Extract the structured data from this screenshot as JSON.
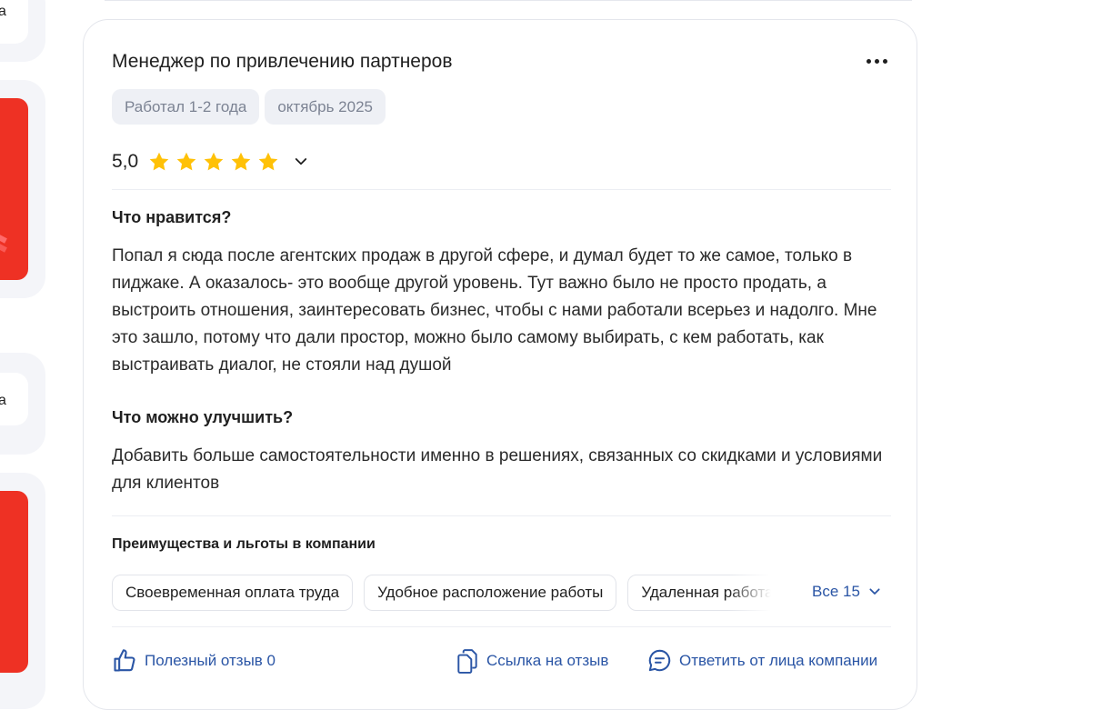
{
  "left_column": {
    "char_top": "а",
    "char_mid": "а"
  },
  "review": {
    "title": "Менеджер по привлечению партнеров",
    "tags": [
      "Работал 1-2 года",
      "октябрь 2025"
    ],
    "rating": {
      "score": "5,0",
      "stars": 5,
      "max": 5
    },
    "likes_title": "Что нравится?",
    "likes_text": "Попал я сюда после агентских продаж в другой сфере, и думал будет то же самое, только в пиджаке. А оказалось- это вообще другой уровень. Тут важно было не просто продать, а выстроить отношения, заинтересовать бизнес, чтобы с нами работали всерьез и надолго. Мне это зашло, потому что дали простор, можно было самому выбирать, с кем работать, как выстраивать диалог, не стояли над душой",
    "improve_title": "Что можно улучшить?",
    "improve_text": "Добавить больше самостоятельности именно в решениях, связанных со скидками и условиями для клиентов",
    "benefits": {
      "title": "Преимущества и льготы в компании",
      "chips": [
        "Своевременная оплата труда",
        "Удобное расположение работы",
        "Удаленная работа"
      ],
      "all_label": "Все 15"
    },
    "actions": {
      "helpful": "Полезный отзыв 0",
      "link": "Ссылка на отзыв",
      "reply": "Ответить от лица компании"
    }
  },
  "colors": {
    "accent": "#2a55a5",
    "star": "#ffc107",
    "banner": "#ee3124",
    "tag_bg": "#eef0f5"
  }
}
